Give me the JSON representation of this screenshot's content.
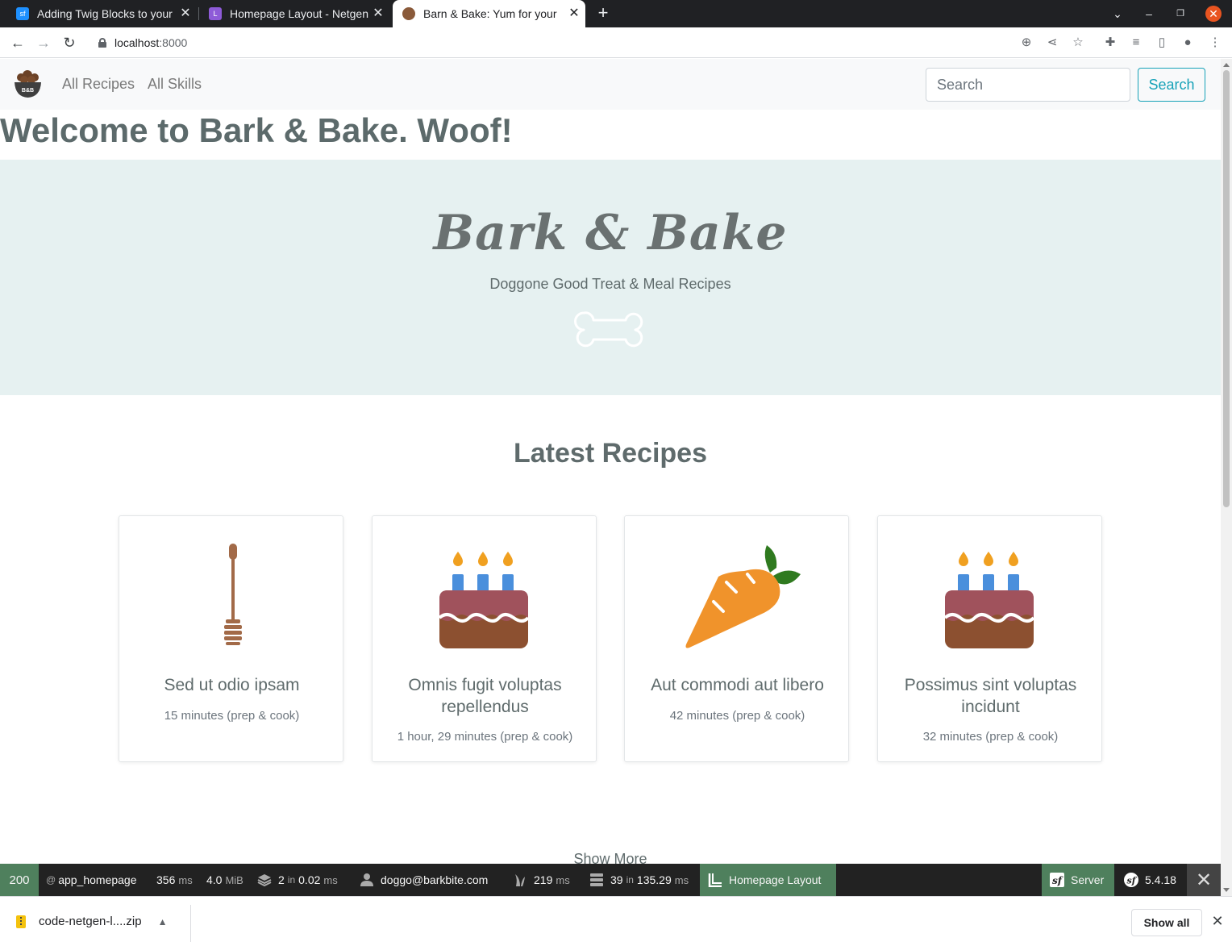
{
  "browser": {
    "tabs": [
      {
        "title": "Adding Twig Blocks to your"
      },
      {
        "title": "Homepage Layout - Netgen"
      },
      {
        "title": "Barn & Bake: Yum for your"
      }
    ],
    "url_host": "localhost",
    "url_port": ":8000"
  },
  "site": {
    "nav": {
      "recipes": "All Recipes",
      "skills": "All Skills"
    },
    "logo_text": "B&B",
    "search": {
      "placeholder": "Search",
      "button": "Search"
    },
    "welcome": "Welcome to Bark & Bake. Woof!",
    "hero": {
      "title": "Bark & Bake",
      "subtitle": "Doggone Good Treat & Meal Recipes"
    },
    "latest_heading": "Latest Recipes",
    "recipes": [
      {
        "title": "Sed ut odio ipsam",
        "time": "15 minutes (prep & cook)",
        "icon": "honey-dipper-icon"
      },
      {
        "title": "Omnis fugit voluptas repellendus",
        "time": "1 hour, 29 minutes (prep & cook)",
        "icon": "birthday-cake-icon"
      },
      {
        "title": "Aut commodi aut libero",
        "time": "42 minutes (prep & cook)",
        "icon": "carrot-icon"
      },
      {
        "title": "Possimus sint voluptas incidunt",
        "time": "32 minutes (prep & cook)",
        "icon": "birthday-cake-icon"
      }
    ],
    "show_more": "Show More"
  },
  "debug_toolbar": {
    "status": "200",
    "route": "app_homepage",
    "time": "356",
    "time_unit": "ms",
    "memory": "4.0",
    "memory_unit": "MiB",
    "cache_count": "2",
    "cache_in": "in",
    "cache_time": "0.02",
    "cache_unit": "ms",
    "user": "doggo@barkbite.com",
    "twig_time": "219",
    "twig_unit": "ms",
    "db_queries": "39",
    "db_in": "in",
    "db_time": "135.29",
    "db_unit": "ms",
    "layout": "Homepage Layout",
    "server": "Server",
    "version": "5.4.18"
  },
  "downloads": {
    "file": "code-netgen-l....zip",
    "show_all": "Show all"
  },
  "colors": {
    "accent": "#17a2b8",
    "hero_bg": "#e6f1f1",
    "debug_green": "#4f805d"
  }
}
